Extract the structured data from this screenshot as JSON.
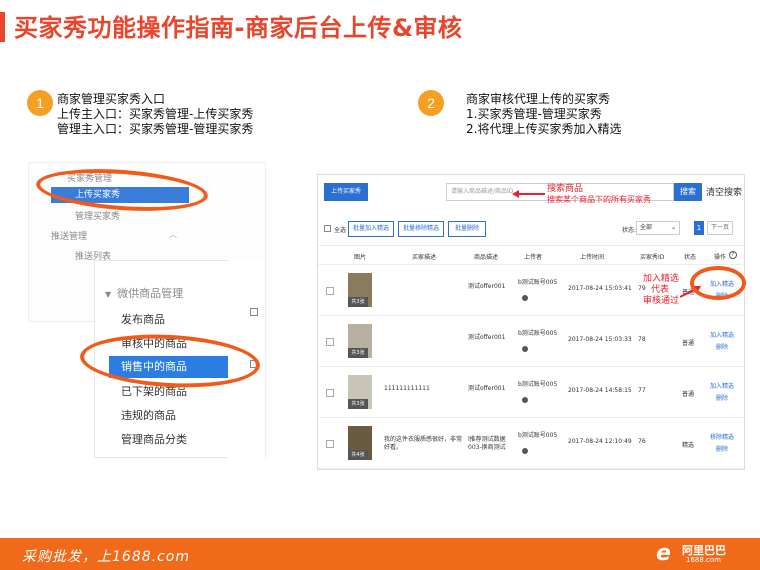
{
  "title": "买家秀功能操作指南-商家后台上传&审核",
  "step1": {
    "number": "1",
    "lines": [
      "商家管理买家秀入口",
      "上传主入口：买家秀管理-上传买家秀",
      "管理主入口：买家秀管理-管理买家秀"
    ]
  },
  "step2": {
    "number": "2",
    "lines": [
      "商家审核代理上传的买家秀",
      "1.买家秀管理-管理买家秀",
      "2.将代理上传买家秀加入精选"
    ]
  },
  "left_menu": {
    "group1": "买家秀管理",
    "active": "上传买家秀",
    "item2": "管理买家秀",
    "group2": "推送管理",
    "item3": "推送列表"
  },
  "left_panel": {
    "heading": "微供商品管理",
    "items": [
      "发布商品",
      "审核中的商品",
      "销售中的商品",
      "已下架的商品",
      "违规的商品",
      "管理商品分类"
    ],
    "active_index": 2
  },
  "right": {
    "upload_button": "上传买家秀",
    "search_placeholder": "请输入商品描述/商品ID",
    "search_button": "搜索",
    "clear_button": "清空搜索",
    "select_all": "全选",
    "toolbar_buttons": [
      "批量加入精选",
      "批量移除精选",
      "批量删除"
    ],
    "status_label": "状态:",
    "status_value": "全部",
    "page_current": "1",
    "page_next": "下一页",
    "columns": [
      "图片",
      "买家描述",
      "商品描述",
      "上传者",
      "上传时间",
      "买家秀ID",
      "状态",
      "操作"
    ],
    "rows": [
      {
        "count": "共3张",
        "desc": "",
        "product": "测试offer001",
        "uploader": "b测试账号005",
        "time": "2017-08-24 15:03:41",
        "id": "79",
        "status": "普通",
        "action1": "加入精选",
        "action2": "删除",
        "thumb": "#8a7a5e"
      },
      {
        "count": "共3张",
        "desc": "",
        "product": "测试offer001",
        "uploader": "b测试账号005",
        "time": "2017-08-24 15:03:33",
        "id": "78",
        "status": "普通",
        "action1": "加入精选",
        "action2": "删除",
        "thumb": "#b8b0a0"
      },
      {
        "count": "共3张",
        "desc": "111111111111",
        "product": "测试offer001",
        "uploader": "b测试账号005",
        "time": "2017-08-24 14:58:15",
        "id": "77",
        "status": "普通",
        "action1": "加入精选",
        "action2": "删除",
        "thumb": "#c8c4b8"
      },
      {
        "count": "共4张",
        "desc": "我的这件衣服质感很好，非常好看。",
        "product": "l推荐测试数据003-换商测试",
        "uploader": "b测试账号005",
        "time": "2017-08-24 12:10:49",
        "id": "76",
        "status": "精选",
        "action1": "移除精选",
        "action2": "删除",
        "thumb": "#6a5a40"
      }
    ]
  },
  "annotations": {
    "search": [
      "搜索商品",
      "搜索某个商品下的所有买家秀"
    ],
    "approve": [
      "加入精选",
      "代表",
      "审核通过"
    ]
  },
  "footer": {
    "slogan": "采购批发，上1688.com",
    "logo_name": "阿里巴巴",
    "logo_url": "1688.com"
  },
  "colors": {
    "accent": "#e8452c",
    "ring": "#f25a1a",
    "footer": "#f06a1a",
    "primary": "#2b6fd3"
  }
}
